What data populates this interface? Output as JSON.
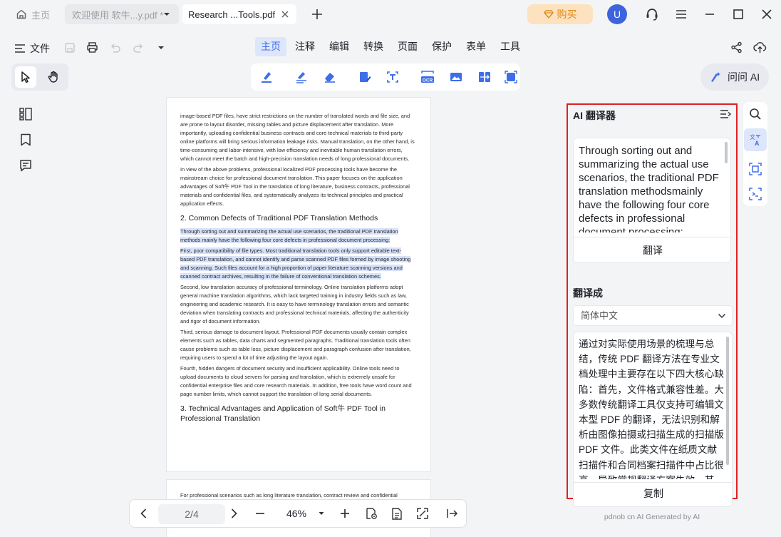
{
  "titlebar": {
    "home_label": "主页",
    "tabs": [
      {
        "label": "欢迎使用 软牛...y.pdf *"
      },
      {
        "label": "Research ...Tools.pdf"
      }
    ],
    "buy_label": "购买",
    "avatar_initial": "U"
  },
  "menu": {
    "file_label": "文件",
    "tabs": [
      "主页",
      "注释",
      "编辑",
      "转换",
      "页面",
      "保护",
      "表单",
      "工具"
    ],
    "active_tab": "主页"
  },
  "toolbar": {
    "ask_ai_label": "问问 AI"
  },
  "document": {
    "page1_paragraphs": [
      "image-based PDF files, have strict restrictions on the number of translated words and file size, and are prone to layout disorder, missing tables and picture displacement after translation. More importantly, uploading confidential business contracts and core technical materials to third-party online platforms will bring serious information leakage risks. Manual translation, on the other hand, is time-consuming and labor-intensive, with low efficiency and inevitable human translation errors, which cannot meet the batch and high-precision translation needs of long professional documents.",
      "In view of the above problems, professional localized PDF processing tools have become the mainstream choice for professional document translation. This paper focuses on the application advantages of Soft牛 PDF Tool in the translation of long literature, business contracts, professional materials and confidential files, and systematically analyzes its technical principles and practical application effects."
    ],
    "heading2": "2. Common Defects of Traditional PDF Translation Methods",
    "highlight1": "Through sorting out and summarizing the actual use scenarios, the traditional PDF translation methods mainly have the following four core defects in professional document processing:",
    "highlight2": "First, poor compatibility of file types. Most traditional translation tools only support editable text-based PDF translation, and cannot identify and parse scanned PDF files formed by image shooting and scanning. Such files account for a high proportion of paper literature scanning versions and scanned contract archives, resulting in the failure of conventional translation schemes.",
    "paragraphs2": [
      "Second, low translation accuracy of professional terminology. Online translation platforms adopt general machine translation algorithms, which lack targeted training in industry fields such as law, engineering and academic research. It is easy to have terminology translation errors and semantic deviation when translating contracts and professional technical materials, affecting the authenticity and rigor of document information.",
      "Third, serious damage to document layout. Professional PDF documents usually contain complex elements such as tables, data charts and segmented paragraphs. Traditional translation tools often cause problems such as table loss, picture displacement and paragraph confusion after translation, requiring users to spend a lot of time adjusting the layout again.",
      "Fourth, hidden dangers of document security and insufficient applicability. Online tools need to upload documents to cloud servers for parsing and translation, which is extremely unsafe for confidential enterprise files and core research materials. In addition, free tools have word count and page number limits, which cannot support the translation of long serial documents."
    ],
    "heading3": "3. Technical Advantages and Application of Soft牛 PDF Tool in Professional Translation",
    "page2_first_line": "For professional scenarios such as long literature translation, contract review and confidential"
  },
  "bottombar": {
    "page_indicator": "2/4",
    "zoom": "46%"
  },
  "ai_panel": {
    "title": "AI 翻译器",
    "source_text": "Through sorting out and summarizing the actual use scenarios, the traditional PDF translation methodsmainly have the following four core defects in professional document processing:",
    "translate_label": "翻译",
    "translate_to_label": "翻译成",
    "target_language": "简体中文",
    "output_text": "通过对实际使用场景的梳理与总结，传统 PDF 翻译方法在专业文档处理中主要存在以下四大核心缺陷：首先，文件格式兼容性差。大多数传统翻译工具仅支持可编辑文本型 PDF 的翻译，无法识别和解析由图像拍摄或扫描生成的扫描版 PDF 文件。此类文件在纸质文献扫描件和合同档案扫描件中占比很高，导致常规翻译方案失效。其次，",
    "copy_label": "复制",
    "footer": "pdnob cn AI Generated by AI"
  },
  "colors": {
    "accent": "#3e6ee8",
    "highlight": "#d7e2fb",
    "panel_border": "#e02020",
    "buy_bg": "#fde2bf",
    "buy_text": "#e08a15",
    "avatar": "#3d63dd"
  },
  "icons": {
    "titlebar": [
      "home-icon",
      "close-icon",
      "plus-icon",
      "diamond-icon",
      "headset-icon",
      "hamburger-icon",
      "minimize-icon",
      "maximize-icon",
      "window-close-icon"
    ],
    "menu": [
      "menu-icon",
      "save-icon",
      "print-icon",
      "undo-icon",
      "redo-icon",
      "dropdown-icon",
      "share-icon",
      "cloud-upload-icon"
    ],
    "tools": [
      "select-arrow-icon",
      "hand-icon",
      "highlight-icon",
      "underline-icon",
      "eraser-icon",
      "edit-pdf-icon",
      "text-recognize-icon",
      "ocr-icon",
      "image-icon",
      "compare-icon",
      "screen-capture-icon",
      "ai-sparkle-icon"
    ],
    "left_sidebar": [
      "thumbnails-icon",
      "bookmark-icon",
      "comment-icon"
    ],
    "right_sidebar": [
      "search-icon",
      "translate-icon",
      "crop-icon",
      "screen-ocr-icon"
    ],
    "bottom": [
      "prev-page-icon",
      "next-page-icon",
      "zoom-out-icon",
      "zoom-in-icon",
      "zoom-dropdown-icon",
      "view-mode-icon",
      "page-icon",
      "fit-screen-icon",
      "collapse-icon"
    ]
  }
}
